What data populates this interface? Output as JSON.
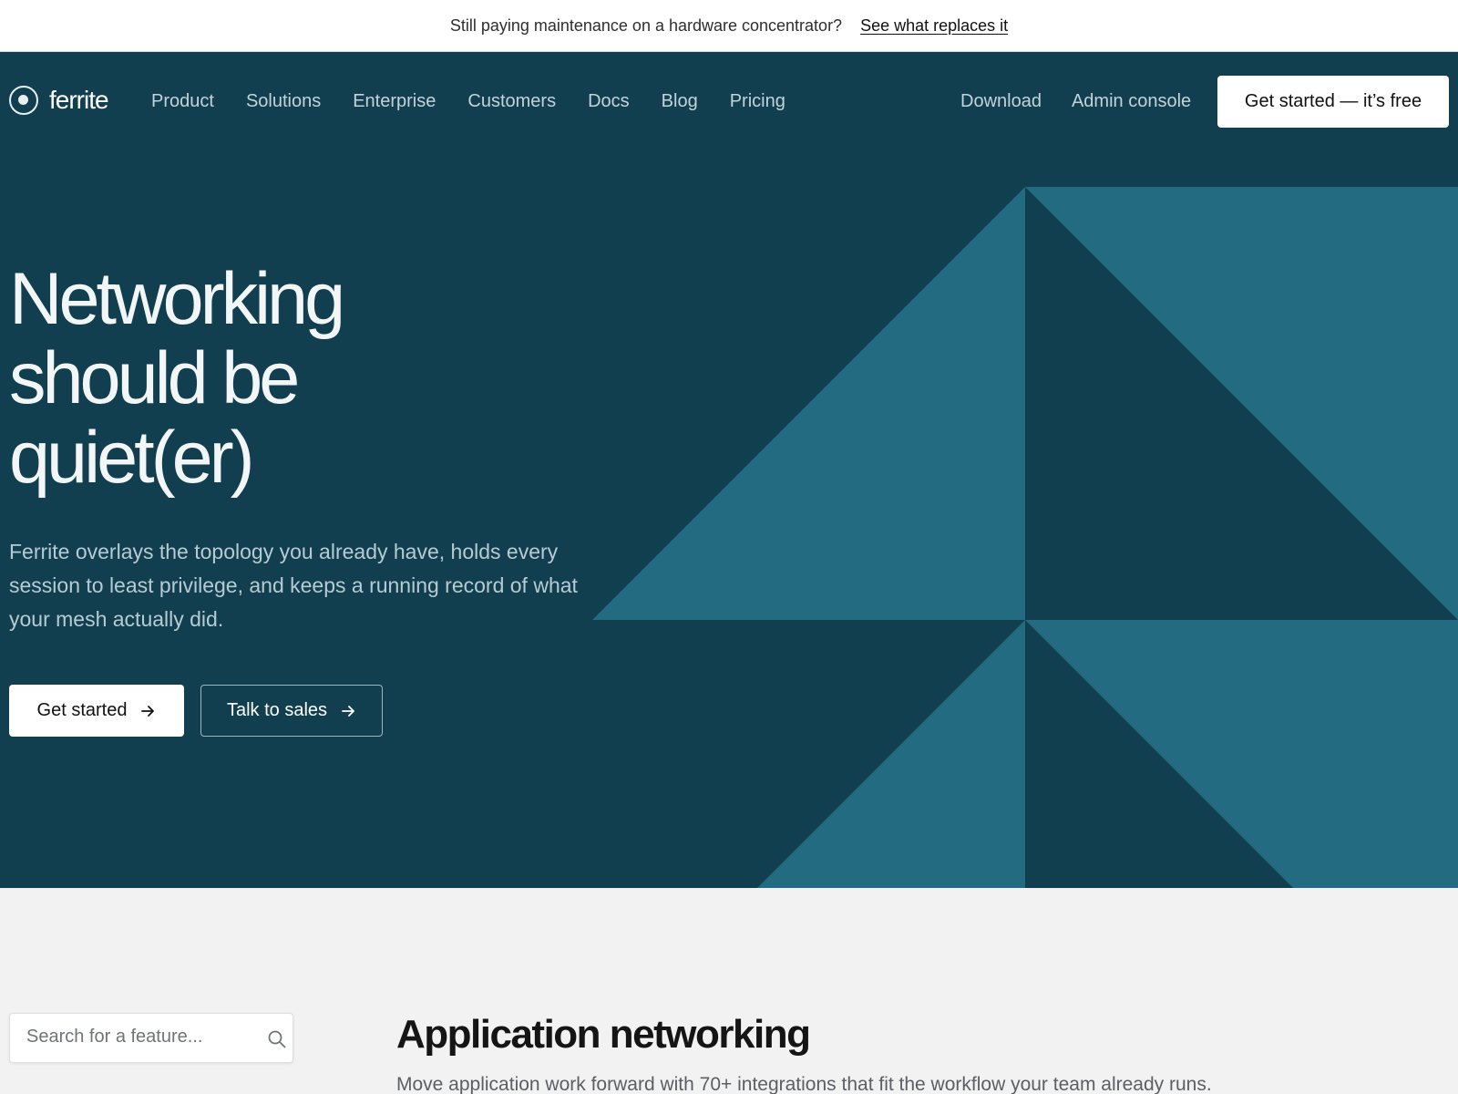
{
  "announcement": {
    "text": "Still paying maintenance on a hardware concentrator?",
    "link": "See what replaces it"
  },
  "brand": {
    "name": "ferrite",
    "logo_icon": "ring-dot-logo-icon"
  },
  "nav": {
    "links": [
      "Product",
      "Solutions",
      "Enterprise",
      "Customers",
      "Docs",
      "Blog",
      "Pricing"
    ],
    "secondary": [
      "Download",
      "Admin console"
    ],
    "cta": "Get started — it’s free"
  },
  "hero": {
    "headline_lines": [
      "Networking",
      "should be",
      "quiet(er)"
    ],
    "lede": "Ferrite overlays the topology you already have, holds every session to least privilege, and keeps a running record of what your mesh actually did.",
    "primary_button": "Get started",
    "secondary_button": "Talk to sales",
    "arrow_icon": "arrow-right-icon"
  },
  "features": {
    "search_placeholder": "Search for a feature...",
    "search_icon": "search-icon",
    "title": "Application networking",
    "subtitle": "Move application work forward with 70+ integrations that fit the workflow your team already runs."
  },
  "colors": {
    "hero_background": "#113f50",
    "hero_accent": "#236b80",
    "page_background": "#f2f2f2",
    "button_background": "#ffffff"
  }
}
